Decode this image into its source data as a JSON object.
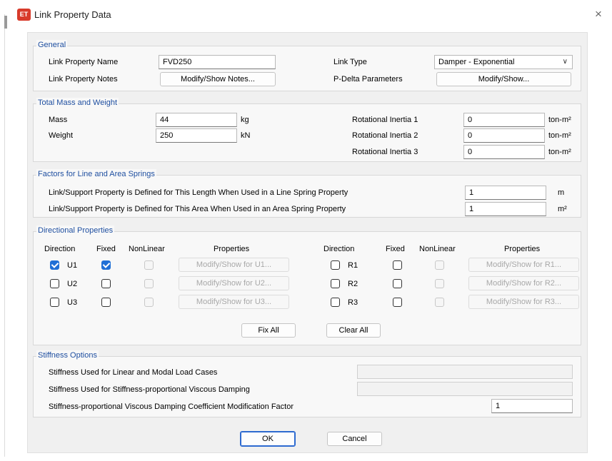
{
  "window": {
    "app_icon": "ET",
    "title": "Link Property Data",
    "close_icon": "×"
  },
  "general": {
    "title": "General",
    "name_label": "Link Property Name",
    "name_value": "FVD250",
    "notes_label": "Link Property Notes",
    "notes_button": "Modify/Show Notes...",
    "type_label": "Link Type",
    "type_value": "Damper - Exponential",
    "pdelta_label": "P-Delta Parameters",
    "pdelta_button": "Modify/Show..."
  },
  "mass": {
    "title": "Total Mass and Weight",
    "mass_label": "Mass",
    "mass_value": "44",
    "mass_unit": "kg",
    "weight_label": "Weight",
    "weight_value": "250",
    "weight_unit": "kN",
    "rot1_label": "Rotational Inertia 1",
    "rot1_value": "0",
    "rot2_label": "Rotational Inertia 2",
    "rot2_value": "0",
    "rot3_label": "Rotational Inertia 3",
    "rot3_value": "0",
    "rot_unit": "ton-m²"
  },
  "springs": {
    "title": "Factors for Line and Area Springs",
    "line_label": "Link/Support Property is Defined for This Length When Used in a Line Spring Property",
    "line_value": "1",
    "line_unit": "m",
    "area_label": "Link/Support Property is Defined for This Area When Used in an Area Spring Property",
    "area_value": "1",
    "area_unit": "m²"
  },
  "directional": {
    "title": "Directional Properties",
    "hdr_direction": "Direction",
    "hdr_fixed": "Fixed",
    "hdr_nonlinear": "NonLinear",
    "hdr_properties": "Properties",
    "left": [
      {
        "label": "U1",
        "checked": true,
        "fixed": true,
        "button": "Modify/Show for U1..."
      },
      {
        "label": "U2",
        "checked": false,
        "fixed": false,
        "button": "Modify/Show for U2..."
      },
      {
        "label": "U3",
        "checked": false,
        "fixed": false,
        "button": "Modify/Show for U3..."
      }
    ],
    "right": [
      {
        "label": "R1",
        "checked": false,
        "fixed": false,
        "button": "Modify/Show for R1..."
      },
      {
        "label": "R2",
        "checked": false,
        "fixed": false,
        "button": "Modify/Show for R2..."
      },
      {
        "label": "R3",
        "checked": false,
        "fixed": false,
        "button": "Modify/Show for R3..."
      }
    ],
    "fix_all": "Fix All",
    "clear_all": "Clear All"
  },
  "stiffness": {
    "title": "Stiffness Options",
    "linear_label": "Stiffness Used for Linear and Modal Load Cases",
    "linear_value": "",
    "damping_label": "Stiffness Used for Stiffness-proportional Viscous Damping",
    "damping_value": "",
    "factor_label": "Stiffness-proportional Viscous Damping Coefficient Modification Factor",
    "factor_value": "1"
  },
  "footer": {
    "ok": "OK",
    "cancel": "Cancel"
  },
  "colors": {
    "accent": "#1f6fd6",
    "group_title": "#1f4fa0"
  }
}
